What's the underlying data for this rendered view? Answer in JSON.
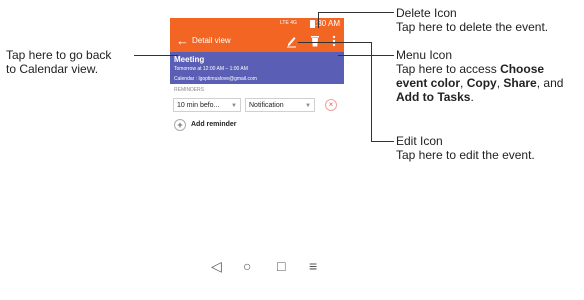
{
  "status_bar": {
    "time": "0:30 AM",
    "indicator": "LTE 4G"
  },
  "app_bar": {
    "title": "Detail view"
  },
  "event": {
    "title": "Meeting",
    "time": "Tomorrow at 12:00 AM – 1:00 AM",
    "calendar": "Calendar : lgoptimuslove@gmail.com"
  },
  "reminders": {
    "header": "REMINDERS",
    "time_value": "10 min befo...",
    "type_value": "Notification",
    "add_label": "Add reminder"
  },
  "callouts": {
    "delete_title": "Delete Icon",
    "delete_desc": "Tap here to delete the event.",
    "menu_title": "Menu Icon",
    "menu_desc_1": "Tap here to access ",
    "menu_opt_1": "Choose",
    "menu_opt_1b": "event color",
    "menu_sep_1": ", ",
    "menu_opt_2": "Copy",
    "menu_sep_2": ", ",
    "menu_opt_3": "Share",
    "menu_sep_3": ", and",
    "menu_opt_4": "Add to Tasks",
    "menu_end": ".",
    "edit_title": "Edit Icon",
    "edit_desc": "Tap here to edit the event.",
    "back_desc_1": "Tap here to go back",
    "back_desc_2": "to Calendar view."
  },
  "icons": [
    "back-arrow-icon",
    "edit-icon",
    "delete-icon",
    "menu-icon",
    "close-icon",
    "plus-icon",
    "nav-back-icon",
    "nav-home-icon",
    "nav-recents-icon",
    "nav-menu-icon"
  ],
  "colors": {
    "accent": "#f26522",
    "event": "#5a5fb5"
  }
}
